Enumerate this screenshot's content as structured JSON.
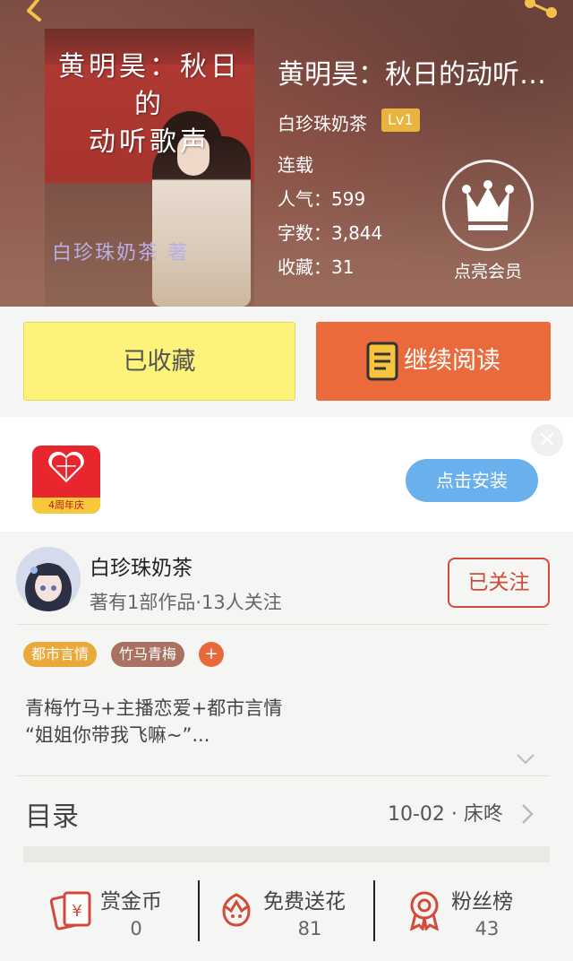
{
  "book": {
    "title": "黄明昊：秋日的动听…",
    "cover_title_line1": "黄明昊：秋日的",
    "cover_title_line2": "动听歌声",
    "cover_author": "白珍珠奶茶  著",
    "author": "白珍珠奶茶",
    "level": "Lv1",
    "status": "连载",
    "popularity": "人气：599",
    "word_count": "字数：3,844",
    "collections": "收藏：31",
    "member_label": "点亮会员"
  },
  "actions": {
    "collected_label": "已收藏",
    "continue_label": "继续阅读"
  },
  "ad": {
    "app_badge": "4周年庆",
    "install_label": "点击安装",
    "close": "×"
  },
  "author_block": {
    "name": "白珍珠奶茶",
    "stats": "著有1部作品·13人关注",
    "follow_label": "已关注"
  },
  "tags": [
    {
      "label": "都市言情",
      "color": "#e9a93b"
    },
    {
      "label": "竹马青梅",
      "color": "#a9715f"
    }
  ],
  "tag_add": "+",
  "description": {
    "line1": "青梅竹马+主播恋爱+都市言情",
    "line2": "“姐姐你带我飞嘛~”..."
  },
  "toc": {
    "title": "目录",
    "latest": "10-02 · 床咚"
  },
  "stats": [
    {
      "label": "赏金币",
      "value": "0",
      "icon": "reward-coin-icon"
    },
    {
      "label": "免费送花",
      "value": "81",
      "icon": "flower-icon"
    },
    {
      "label": "粉丝榜",
      "value": "43",
      "icon": "medal-icon"
    }
  ],
  "colors": {
    "accent_orange": "#ea6a3c",
    "collected_yellow": "#fdf27a",
    "follow_red": "#d24a3a",
    "install_blue": "#6ab0ec"
  }
}
